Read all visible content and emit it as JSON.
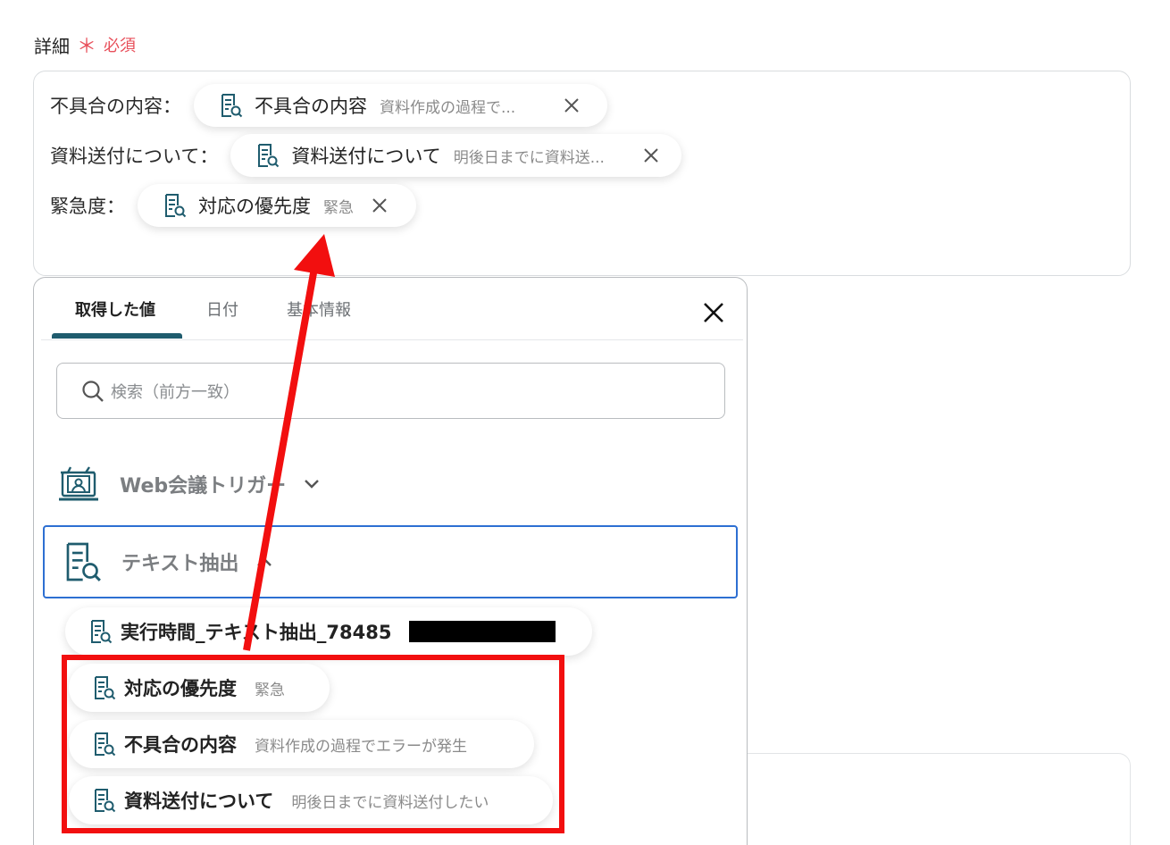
{
  "field": {
    "label": "詳細",
    "required_mark": "＊",
    "required_text": "必須"
  },
  "editor": {
    "rows": [
      {
        "label": "不具合の内容：",
        "chip_name": "不具合の内容",
        "chip_value": "資料作成の過程で..."
      },
      {
        "label": "資料送付について：",
        "chip_name": "資料送付について",
        "chip_value": "明後日までに資料送..."
      },
      {
        "label": "緊急度：",
        "chip_name": "対応の優先度",
        "chip_value": "緊急"
      }
    ]
  },
  "panel": {
    "tabs": [
      "取得した値",
      "日付",
      "基本情報"
    ],
    "search_placeholder": "検索（前方一致）",
    "sections": [
      {
        "title": "Web会議トリガー",
        "expanded": false
      },
      {
        "title": "テキスト抽出",
        "expanded": true
      }
    ],
    "items": [
      {
        "name": "実行時間_テキスト抽出_78485",
        "value": ""
      },
      {
        "name": "対応の優先度",
        "value": "緊急"
      },
      {
        "name": "不具合の内容",
        "value": "資料作成の過程でエラーが発生"
      },
      {
        "name": "資料送付について",
        "value": "明後日までに資料送付したい"
      }
    ]
  },
  "colors": {
    "accent": "#1f5c6e",
    "required": "#e8505b",
    "selection_border": "#2d6fd2",
    "annotation": "#f20f0f"
  }
}
